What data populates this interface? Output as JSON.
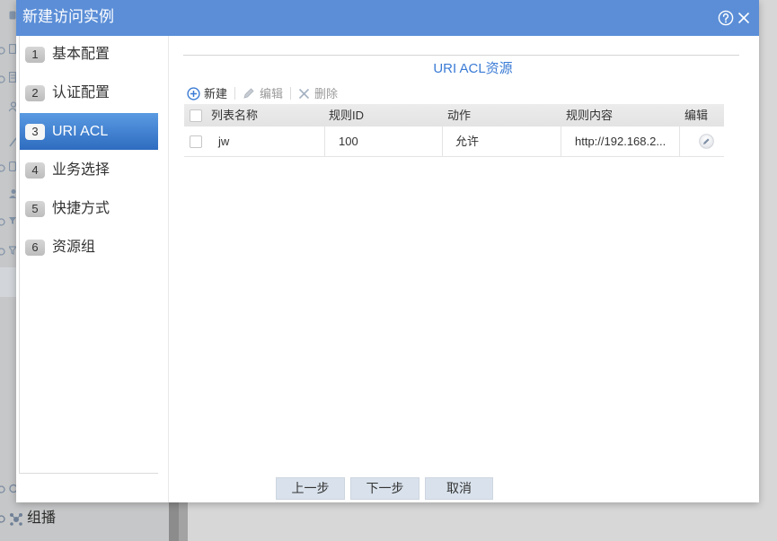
{
  "dialog": {
    "title": "新建访问实例",
    "help_icon": "question-circle-icon",
    "close_icon": "close-icon"
  },
  "steps": [
    {
      "number": "1",
      "label": "基本配置",
      "active": false
    },
    {
      "number": "2",
      "label": "认证配置",
      "active": false
    },
    {
      "number": "3",
      "label": "URI ACL",
      "active": true
    },
    {
      "number": "4",
      "label": "业务选择",
      "active": false
    },
    {
      "number": "5",
      "label": "快捷方式",
      "active": false
    },
    {
      "number": "6",
      "label": "资源组",
      "active": false
    }
  ],
  "section": {
    "title": "URI ACL资源"
  },
  "toolbar": {
    "new": {
      "label": "新建",
      "icon": "plus-circle-icon",
      "enabled": true
    },
    "edit": {
      "label": "编辑",
      "icon": "pencil-icon",
      "enabled": false
    },
    "delete": {
      "label": "删除",
      "icon": "x-icon",
      "enabled": false
    }
  },
  "table": {
    "columns": [
      "列表名称",
      "规则ID",
      "动作",
      "规则内容",
      "编辑"
    ],
    "select_all_checked": false,
    "rows": [
      {
        "checked": false,
        "name": "jw",
        "rule_id": "100",
        "action": "允许",
        "content": "http://192.168.2...",
        "edit_icon": "edit-circle-icon"
      }
    ]
  },
  "footer": {
    "prev_label": "上一步",
    "next_label": "下一步",
    "cancel_label": "取消"
  },
  "background_page": {
    "sidebar_item_label": "组播",
    "sidebar_item_icon": "multicast-icon"
  },
  "colors": {
    "title_bar": "#5b8ed7",
    "accent": "#3b7bd4",
    "active_step_top": "#5a9ae2",
    "active_step_bottom": "#2e6cc0",
    "section_title": "#3a7bd5"
  }
}
